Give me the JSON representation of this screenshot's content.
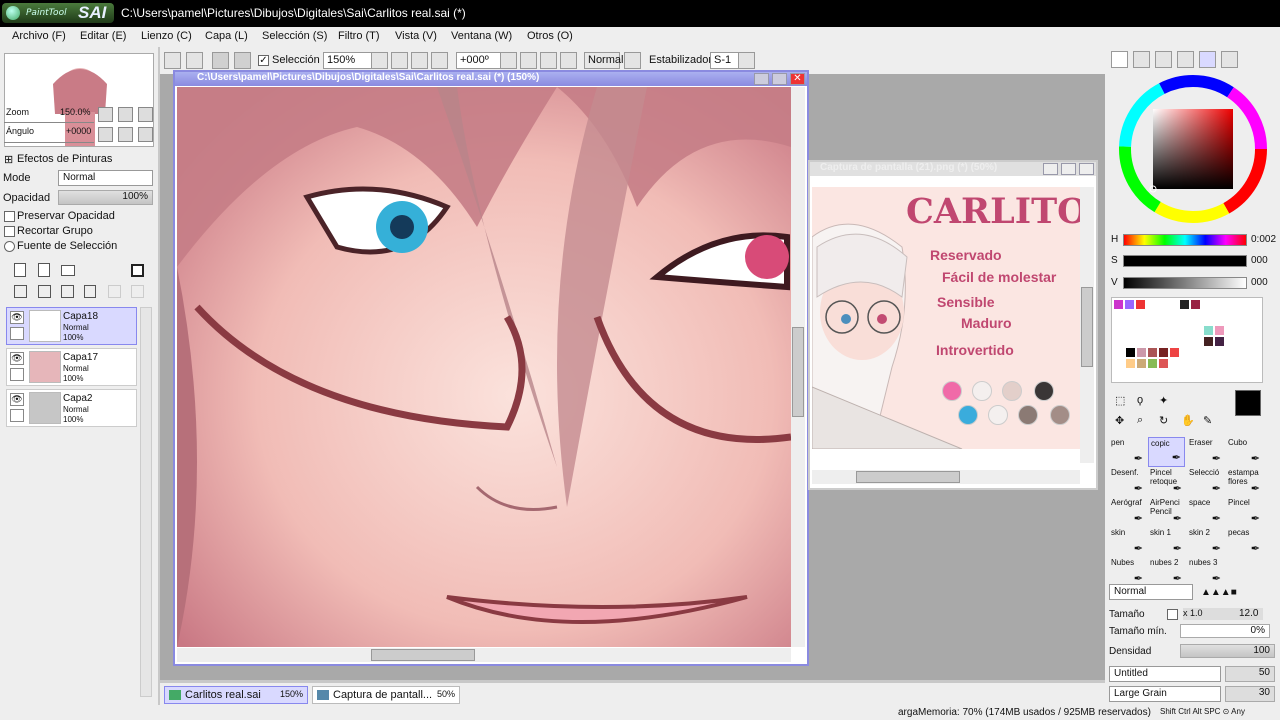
{
  "window": {
    "title": "C:\\Users\\pamel\\Pictures\\Dibujos\\Digitales\\Sai\\Carlitos real.sai (*)",
    "logo_small": "PaintTool",
    "logo_big": "SAI"
  },
  "menu": [
    "Archivo (F)",
    "Editar (E)",
    "Lienzo (C)",
    "Capa (L)",
    "Selección (S)",
    "Filtro (T)",
    "Vista (V)",
    "Ventana (W)",
    "Otros (O)"
  ],
  "toolbar": {
    "selection_label": "Selección",
    "zoom": "150%",
    "rotation": "+000º",
    "blend": "Normal",
    "stabilizer_label": "Estabilizador",
    "stabilizer": "S-1"
  },
  "nav": {
    "zoom_label": "Zoom",
    "zoom_value": "150.0%",
    "angle_label": "Ángulo",
    "angle_value": "+0000"
  },
  "layer_panel": {
    "effects": "Efectos de Pinturas",
    "mode_label": "Mode",
    "mode_value": "Normal",
    "opacity_label": "Opacidad",
    "opacity_value": "100%",
    "options": [
      "Preservar Opacidad",
      "Recortar Grupo",
      "Fuente de Selección"
    ],
    "layers": [
      {
        "name": "Capa18",
        "mode": "Normal",
        "opacity": "100%"
      },
      {
        "name": "Capa17",
        "mode": "Normal",
        "opacity": "100%"
      },
      {
        "name": "Capa2",
        "mode": "Normal",
        "opacity": "100%"
      }
    ]
  },
  "main_canvas": {
    "title": "C:\\Users\\pamel\\Pictures\\Dibujos\\Digitales\\Sai\\Carlitos real.sai (*) (150%)"
  },
  "ref_window": {
    "title": "Captura de pantalla (21).png (*) (50%)",
    "name": "CARLITOS",
    "traits": [
      "Reservado",
      "Fácil de molestar",
      "Sensible",
      "Maduro",
      "Introvertido"
    ],
    "palette": [
      "#f06aa8",
      "#f4efee",
      "#e3cfca",
      "#3a3636",
      "#3aacdc",
      "#f4f0ef",
      "#8b7a74",
      "#a38d87"
    ]
  },
  "color": {
    "h_label": "H",
    "h_value": "0:002",
    "s_label": "S",
    "s_value": "000",
    "v_label": "V",
    "v_value": "000"
  },
  "tools": [
    {
      "label": "pen"
    },
    {
      "label": "copic"
    },
    {
      "label": "Eraser"
    },
    {
      "label": "Cubo"
    },
    {
      "label": "Desenf."
    },
    {
      "label": "Pincel retoque"
    },
    {
      "label": "Selecció"
    },
    {
      "label": "estampa flores"
    },
    {
      "label": "Aerógraf"
    },
    {
      "label": "AirPenci Pencil"
    },
    {
      "label": "space"
    },
    {
      "label": "Pincel"
    },
    {
      "label": "skin"
    },
    {
      "label": "skin 1"
    },
    {
      "label": "skin 2"
    },
    {
      "label": "pecas"
    },
    {
      "label": "Nubes"
    },
    {
      "label": "nubes 2"
    },
    {
      "label": "nubes 3"
    }
  ],
  "brush": {
    "mode": "Normal",
    "size_label": "Tamaño",
    "size_mult": "x 1.0",
    "size_value": "12.0",
    "min_label": "Tamaño mín.",
    "min_value": "0%",
    "density_label": "Densidad",
    "density_value": "100",
    "texture": "Untitled",
    "texture_value": "50",
    "grain": "Large Grain",
    "grain_value": "30"
  },
  "tabs": [
    {
      "name": "Carlitos real.sai",
      "zoom": "150%"
    },
    {
      "name": "Captura de pantall...",
      "zoom": "50%"
    }
  ],
  "status": {
    "memory": "argaMemoria: 70% (174MB usados / 925MB reservados)",
    "keys": "Shift Ctrl Alt SPC ⊙ Any"
  }
}
